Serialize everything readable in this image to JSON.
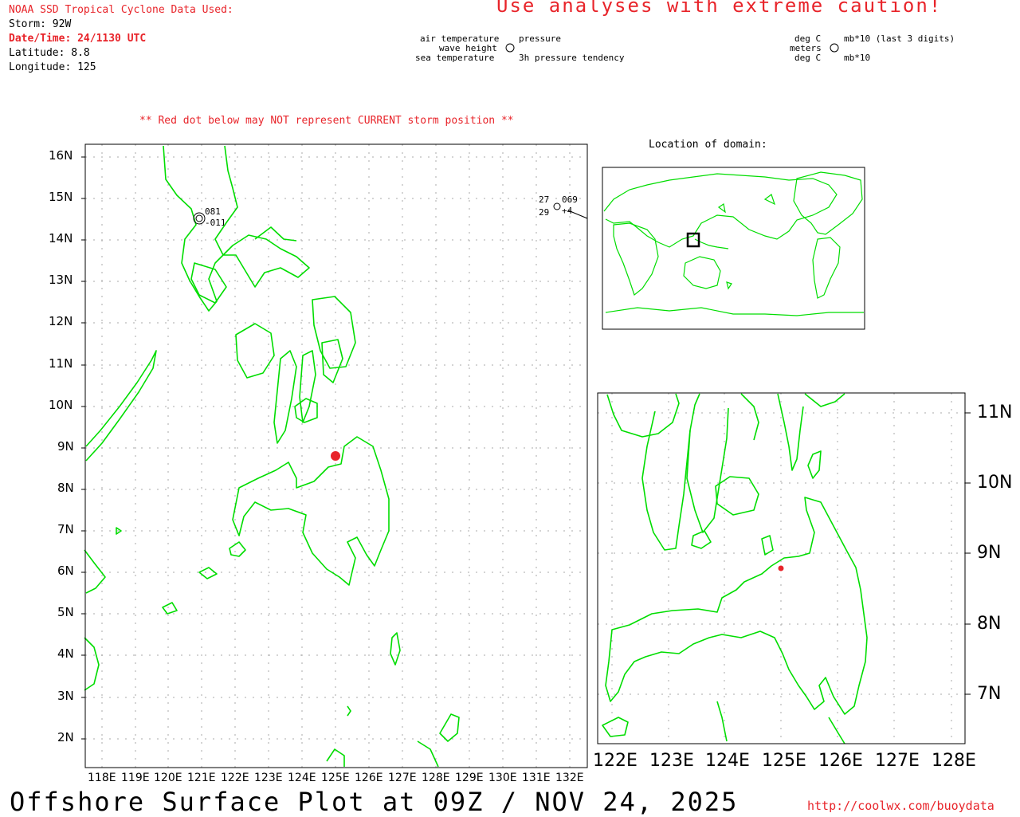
{
  "header": {
    "source_title": "NOAA SSD Tropical Cyclone Data Used:",
    "storm": "Storm: 92W",
    "datetime": "Date/Time: 24/1130 UTC",
    "latitude": "Latitude: 8.8",
    "longitude": "Longitude: 125",
    "caution": "Use analyses with extreme caution!"
  },
  "legend": {
    "air_temperature": "air temperature",
    "wave_height": "wave height",
    "sea_temperature": "sea temperature",
    "pressure": "pressure",
    "pressure_tendency": "3h pressure tendency",
    "unit_air": "deg C",
    "unit_wave": "meters",
    "unit_sea": "deg C",
    "unit_pressure": "mb*10 (last 3 digits)",
    "unit_tendency": "mb*10"
  },
  "notice": "** Red dot below may NOT represent CURRENT storm position **",
  "inset_title": "Location of domain:",
  "main_map": {
    "lat_labels": [
      "16N",
      "15N",
      "14N",
      "13N",
      "12N",
      "11N",
      "10N",
      "9N",
      "8N",
      "7N",
      "6N",
      "5N",
      "4N",
      "3N",
      "2N"
    ],
    "lon_labels": [
      "118E",
      "119E",
      "120E",
      "121E",
      "122E",
      "123E",
      "124E",
      "125E",
      "126E",
      "127E",
      "128E",
      "129E",
      "130E",
      "131E",
      "132E"
    ]
  },
  "zoom_map": {
    "lat_labels": [
      "11N",
      "10N",
      "9N",
      "8N",
      "7N"
    ],
    "lon_labels": [
      "122E",
      "123E",
      "124E",
      "125E",
      "126E",
      "127E",
      "128E"
    ]
  },
  "stations": [
    {
      "air_temp": "",
      "pressure": "081",
      "sea_temp": "",
      "tendency": "-011"
    },
    {
      "air_temp": "27",
      "pressure": "069",
      "sea_temp": "29",
      "tendency": "+4"
    }
  ],
  "storm_position": {
    "lat": 8.8,
    "lon": 125
  },
  "colors": {
    "coast": "#00dd00",
    "storm_dot": "#e8242a",
    "notice": "#e8242a"
  },
  "footer": {
    "title": "Offshore Surface Plot at 09Z / NOV 24, 2025",
    "url": "http://coolwx.com/buoydata"
  }
}
